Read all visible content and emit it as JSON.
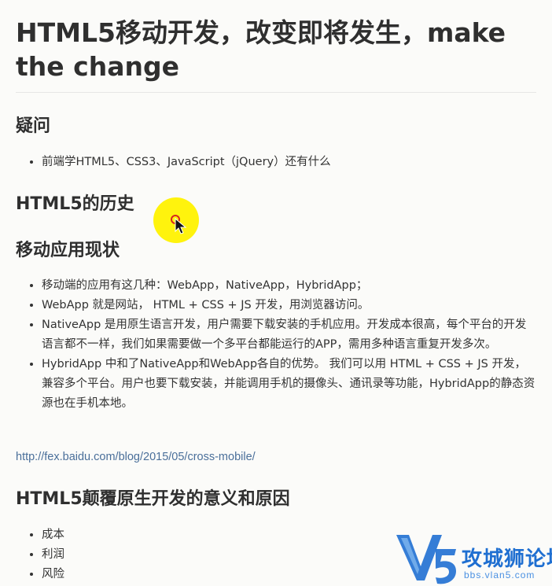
{
  "page": {
    "title": "HTML5移动开发，改变即将发生，make the change",
    "sections": {
      "questions": {
        "heading": "疑问",
        "items": [
          "前端学HTML5、CSS3、JavaScript（jQuery）还有什么"
        ]
      },
      "history": {
        "heading": "HTML5的历史"
      },
      "mobile_status": {
        "heading": "移动应用现状",
        "items": [
          "移动端的应用有这几种：WebApp，NativeApp，HybridApp；",
          "WebApp 就是网站， HTML + CSS + JS 开发，用浏览器访问。",
          "NativeApp 是用原生语言开发，用户需要下载安装的手机应用。开发成本很高，每个平台的开发语言都不一样，我们如果需要做一个多平台都能运行的APP，需用多种语言重复开发多次。",
          "HybridApp 中和了NativeApp和WebApp各自的优势。 我们可以用 HTML + CSS + JS 开发，兼容多个平台。用户也要下载安装，并能调用手机的摄像头、通讯录等功能，HybridApp的静态资源也在手机本地。"
        ],
        "link": "http://fex.baidu.com/blog/2015/05/cross-mobile/"
      },
      "disruption": {
        "heading": "HTML5颠覆原生开发的意义和原因",
        "items": [
          "成本",
          "利润",
          "风险"
        ]
      }
    }
  },
  "watermark": {
    "logo_text": "攻城狮论坛",
    "domain_text": "bbs.vlan5.com",
    "brand_color": "#1f6fd1"
  },
  "cursor": {
    "highlight_color": "#fff200",
    "ring_color": "#d7261e"
  },
  "colors": {
    "text": "#333333",
    "link": "#4a6f9a",
    "background": "#fbfbf9"
  }
}
